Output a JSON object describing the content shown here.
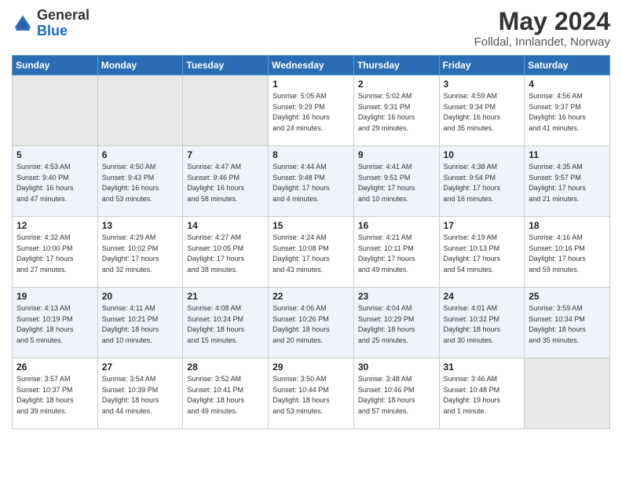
{
  "header": {
    "logo_general": "General",
    "logo_blue": "Blue",
    "title": "May 2024",
    "subtitle": "Folldal, Innlandet, Norway"
  },
  "days_of_week": [
    "Sunday",
    "Monday",
    "Tuesday",
    "Wednesday",
    "Thursday",
    "Friday",
    "Saturday"
  ],
  "weeks": [
    [
      {
        "day": "",
        "info": ""
      },
      {
        "day": "",
        "info": ""
      },
      {
        "day": "",
        "info": ""
      },
      {
        "day": "1",
        "info": "Sunrise: 5:05 AM\nSunset: 9:29 PM\nDaylight: 16 hours\nand 24 minutes."
      },
      {
        "day": "2",
        "info": "Sunrise: 5:02 AM\nSunset: 9:31 PM\nDaylight: 16 hours\nand 29 minutes."
      },
      {
        "day": "3",
        "info": "Sunrise: 4:59 AM\nSunset: 9:34 PM\nDaylight: 16 hours\nand 35 minutes."
      },
      {
        "day": "4",
        "info": "Sunrise: 4:56 AM\nSunset: 9:37 PM\nDaylight: 16 hours\nand 41 minutes."
      }
    ],
    [
      {
        "day": "5",
        "info": "Sunrise: 4:53 AM\nSunset: 9:40 PM\nDaylight: 16 hours\nand 47 minutes."
      },
      {
        "day": "6",
        "info": "Sunrise: 4:50 AM\nSunset: 9:43 PM\nDaylight: 16 hours\nand 53 minutes."
      },
      {
        "day": "7",
        "info": "Sunrise: 4:47 AM\nSunset: 9:46 PM\nDaylight: 16 hours\nand 58 minutes."
      },
      {
        "day": "8",
        "info": "Sunrise: 4:44 AM\nSunset: 9:48 PM\nDaylight: 17 hours\nand 4 minutes."
      },
      {
        "day": "9",
        "info": "Sunrise: 4:41 AM\nSunset: 9:51 PM\nDaylight: 17 hours\nand 10 minutes."
      },
      {
        "day": "10",
        "info": "Sunrise: 4:38 AM\nSunset: 9:54 PM\nDaylight: 17 hours\nand 16 minutes."
      },
      {
        "day": "11",
        "info": "Sunrise: 4:35 AM\nSunset: 9:57 PM\nDaylight: 17 hours\nand 21 minutes."
      }
    ],
    [
      {
        "day": "12",
        "info": "Sunrise: 4:32 AM\nSunset: 10:00 PM\nDaylight: 17 hours\nand 27 minutes."
      },
      {
        "day": "13",
        "info": "Sunrise: 4:29 AM\nSunset: 10:02 PM\nDaylight: 17 hours\nand 32 minutes."
      },
      {
        "day": "14",
        "info": "Sunrise: 4:27 AM\nSunset: 10:05 PM\nDaylight: 17 hours\nand 38 minutes."
      },
      {
        "day": "15",
        "info": "Sunrise: 4:24 AM\nSunset: 10:08 PM\nDaylight: 17 hours\nand 43 minutes."
      },
      {
        "day": "16",
        "info": "Sunrise: 4:21 AM\nSunset: 10:11 PM\nDaylight: 17 hours\nand 49 minutes."
      },
      {
        "day": "17",
        "info": "Sunrise: 4:19 AM\nSunset: 10:13 PM\nDaylight: 17 hours\nand 54 minutes."
      },
      {
        "day": "18",
        "info": "Sunrise: 4:16 AM\nSunset: 10:16 PM\nDaylight: 17 hours\nand 59 minutes."
      }
    ],
    [
      {
        "day": "19",
        "info": "Sunrise: 4:13 AM\nSunset: 10:19 PM\nDaylight: 18 hours\nand 5 minutes."
      },
      {
        "day": "20",
        "info": "Sunrise: 4:11 AM\nSunset: 10:21 PM\nDaylight: 18 hours\nand 10 minutes."
      },
      {
        "day": "21",
        "info": "Sunrise: 4:08 AM\nSunset: 10:24 PM\nDaylight: 18 hours\nand 15 minutes."
      },
      {
        "day": "22",
        "info": "Sunrise: 4:06 AM\nSunset: 10:26 PM\nDaylight: 18 hours\nand 20 minutes."
      },
      {
        "day": "23",
        "info": "Sunrise: 4:04 AM\nSunset: 10:29 PM\nDaylight: 18 hours\nand 25 minutes."
      },
      {
        "day": "24",
        "info": "Sunrise: 4:01 AM\nSunset: 10:32 PM\nDaylight: 18 hours\nand 30 minutes."
      },
      {
        "day": "25",
        "info": "Sunrise: 3:59 AM\nSunset: 10:34 PM\nDaylight: 18 hours\nand 35 minutes."
      }
    ],
    [
      {
        "day": "26",
        "info": "Sunrise: 3:57 AM\nSunset: 10:37 PM\nDaylight: 18 hours\nand 39 minutes."
      },
      {
        "day": "27",
        "info": "Sunrise: 3:54 AM\nSunset: 10:39 PM\nDaylight: 18 hours\nand 44 minutes."
      },
      {
        "day": "28",
        "info": "Sunrise: 3:52 AM\nSunset: 10:41 PM\nDaylight: 18 hours\nand 49 minutes."
      },
      {
        "day": "29",
        "info": "Sunrise: 3:50 AM\nSunset: 10:44 PM\nDaylight: 18 hours\nand 53 minutes."
      },
      {
        "day": "30",
        "info": "Sunrise: 3:48 AM\nSunset: 10:46 PM\nDaylight: 18 hours\nand 57 minutes."
      },
      {
        "day": "31",
        "info": "Sunrise: 3:46 AM\nSunset: 10:48 PM\nDaylight: 19 hours\nand 1 minute."
      },
      {
        "day": "",
        "info": ""
      }
    ]
  ]
}
